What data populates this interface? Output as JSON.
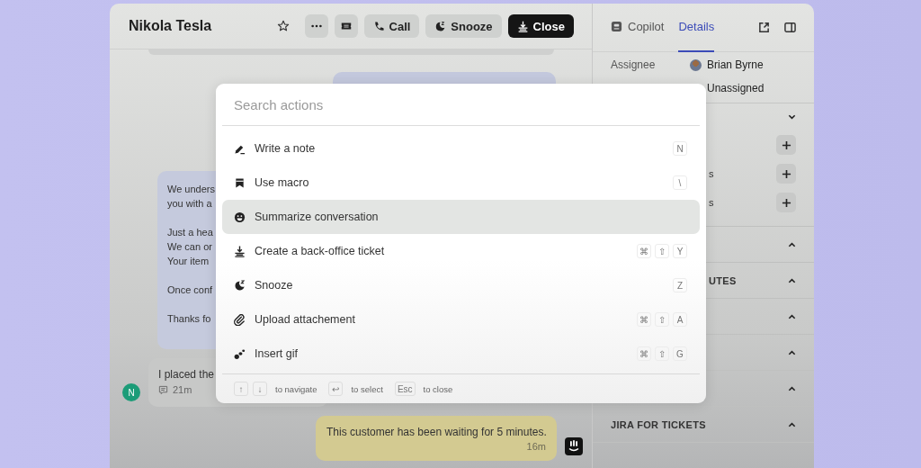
{
  "contact": {
    "name": "Nikola Tesla"
  },
  "header_buttons": [
    {
      "kind": "star"
    },
    {
      "kind": "more"
    },
    {
      "kind": "ticket"
    },
    {
      "kind": "call",
      "label": "Call"
    },
    {
      "kind": "snooze",
      "label": "Snooze"
    },
    {
      "kind": "close",
      "label": "Close"
    }
  ],
  "messages": [
    {
      "kind": "agent",
      "paragraphs": [
        [
          "We unders",
          "you with a"
        ],
        [
          "Just a hea",
          "We can or",
          "Your item"
        ],
        [
          "Once conf"
        ],
        [
          "Thanks fo"
        ]
      ]
    },
    {
      "kind": "customer",
      "avatar": "N",
      "text": "I placed the",
      "time": "21m"
    },
    {
      "kind": "note",
      "text": "This customer has been waiting for 5 minutes.",
      "time": "16m"
    }
  ],
  "side_panel": {
    "tabs": [
      {
        "label": "Copilot",
        "selected": false
      },
      {
        "label": "Details",
        "selected": true
      }
    ],
    "assignee": {
      "label": "Assignee",
      "value": "Brian Byrne"
    },
    "team": {
      "value": "Unassigned"
    },
    "rows": [
      {
        "kind": "section",
        "expanded": false
      },
      {
        "kind": "add"
      },
      {
        "kind": "add",
        "label": "s",
        "partial": true
      },
      {
        "kind": "add",
        "label": "s",
        "partial": true
      },
      {
        "kind": "section",
        "expanded": true
      },
      {
        "kind": "section",
        "label": "UTES",
        "partial": true,
        "expanded": true
      },
      {
        "kind": "section",
        "expanded": true
      },
      {
        "kind": "section",
        "expanded": true
      },
      {
        "kind": "section",
        "expanded": true
      },
      {
        "kind": "section",
        "label": "JIRA FOR TICKETS",
        "partial": false,
        "expanded": true
      }
    ]
  },
  "command_palette": {
    "search": {
      "placeholder": "Search actions"
    },
    "actions": [
      {
        "kind": "note",
        "label": "Write a note",
        "keys": [
          "N"
        ],
        "selected": false
      },
      {
        "kind": "macro",
        "label": "Use macro",
        "keys": [
          "\\"
        ],
        "selected": false
      },
      {
        "kind": "summarize",
        "label": "Summarize conversation",
        "selected": true
      },
      {
        "kind": "ticket",
        "label": "Create a back-office ticket",
        "keys": [
          "⌘",
          "⇧",
          "Y"
        ],
        "selected": false
      },
      {
        "kind": "snooze",
        "label": "Snooze",
        "keys": [
          "Z"
        ],
        "selected": false
      },
      {
        "kind": "attach",
        "label": "Upload attachement",
        "keys": [
          "⌘",
          "⇧",
          "A"
        ],
        "selected": false
      },
      {
        "kind": "gif",
        "label": "Insert gif",
        "keys": [
          "⌘",
          "⇧",
          "G"
        ],
        "selected": false
      }
    ],
    "hints": [
      {
        "keys": [
          "↑",
          "↓"
        ],
        "text": "to navigate"
      },
      {
        "keys": [
          "↩"
        ],
        "text": "to select"
      },
      {
        "keys": [
          "Esc"
        ],
        "text": "to close"
      }
    ]
  }
}
